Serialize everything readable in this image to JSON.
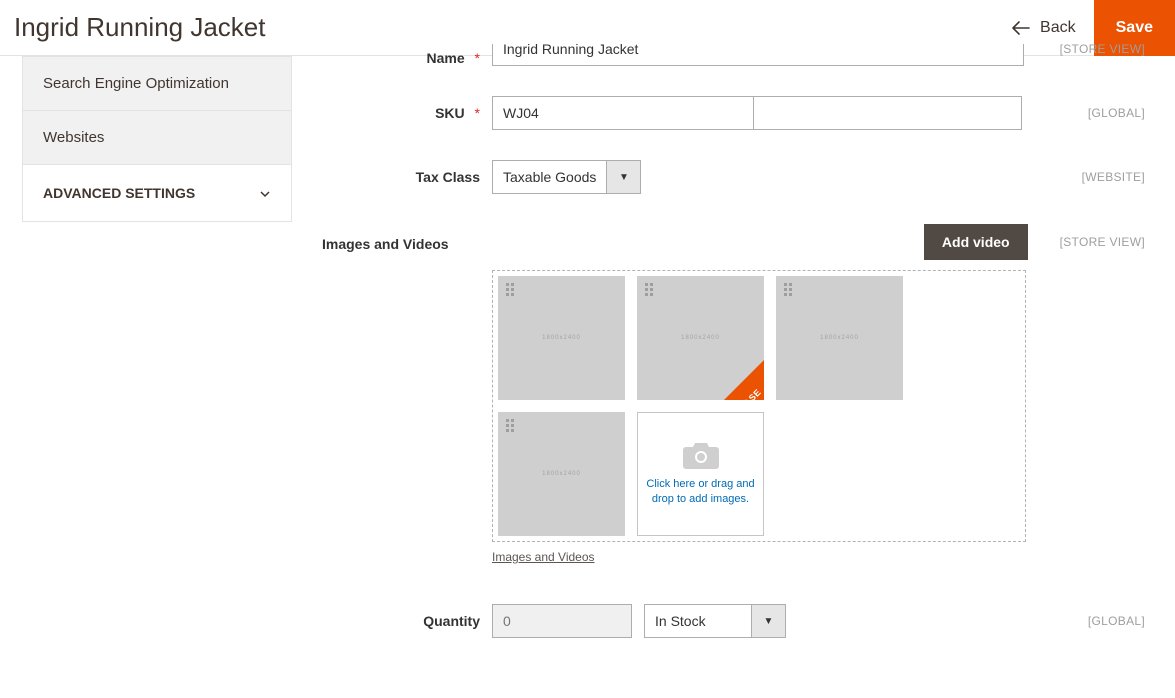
{
  "header": {
    "title": "Ingrid Running Jacket",
    "back_label": "Back",
    "save_label": "Save"
  },
  "sidebar": {
    "items": [
      {
        "label": "Search Engine Optimization"
      },
      {
        "label": "Websites"
      }
    ],
    "advanced_label": "ADVANCED SETTINGS"
  },
  "fields": {
    "name": {
      "label": "Name",
      "value": "Ingrid Running Jacket",
      "scope": "[STORE VIEW]"
    },
    "sku": {
      "label": "SKU",
      "value": "WJ04",
      "scope": "[GLOBAL]"
    },
    "tax_class": {
      "label": "Tax Class",
      "value": "Taxable Goods",
      "scope": "[WEBSITE]"
    },
    "images": {
      "label": "Images and Videos",
      "add_video": "Add video",
      "scope": "[STORE VIEW]",
      "upload_hint": "Click here or drag and drop to add images.",
      "link": "Images and Videos"
    },
    "quantity": {
      "label": "Quantity",
      "value": "",
      "placeholder": "0",
      "stock": "In Stock",
      "scope": "[GLOBAL]"
    }
  }
}
